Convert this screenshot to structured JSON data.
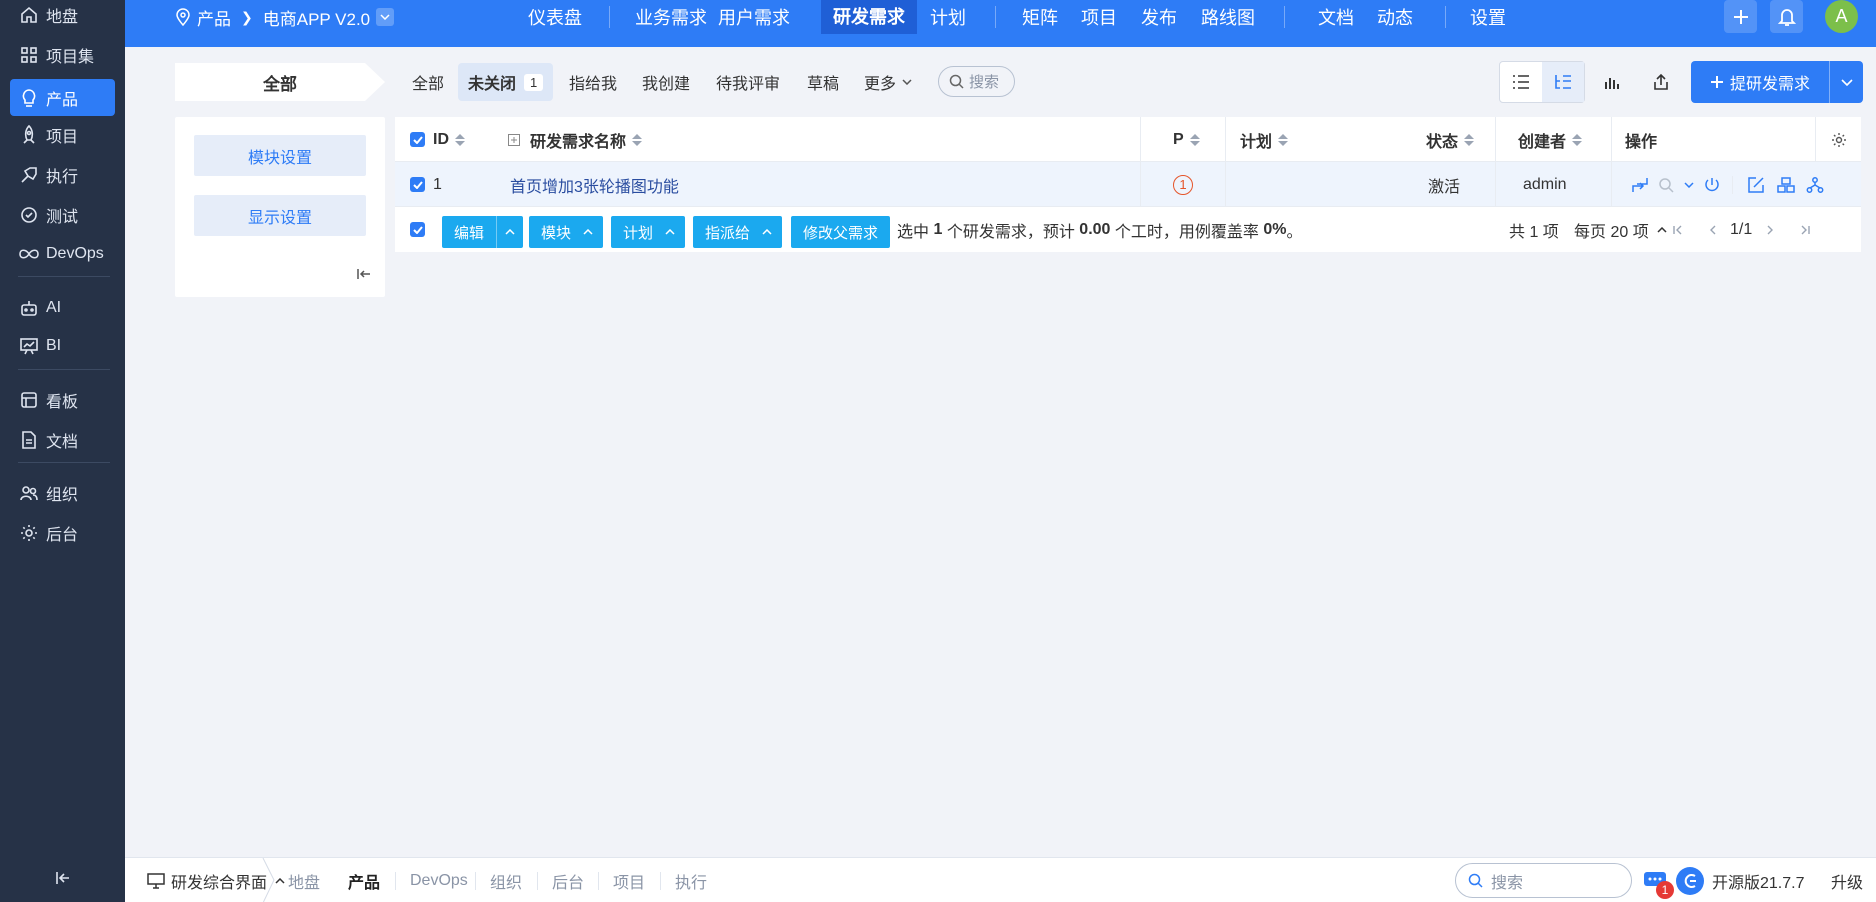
{
  "sidebar": {
    "items": [
      {
        "label": "地盘",
        "icon": "home-icon"
      },
      {
        "label": "项目集",
        "icon": "grid-icon"
      },
      {
        "label": "产品",
        "icon": "bulb-icon"
      },
      {
        "label": "项目",
        "icon": "rocket-icon"
      },
      {
        "label": "执行",
        "icon": "run-icon"
      },
      {
        "label": "测试",
        "icon": "test-icon"
      },
      {
        "label": "DevOps",
        "icon": "infinity-icon"
      },
      {
        "label": "AI",
        "icon": "robot-icon"
      },
      {
        "label": "BI",
        "icon": "chart-board-icon"
      },
      {
        "label": "看板",
        "icon": "kanban-icon"
      },
      {
        "label": "文档",
        "icon": "doc-icon"
      },
      {
        "label": "组织",
        "icon": "users-icon"
      },
      {
        "label": "后台",
        "icon": "gear-icon"
      }
    ],
    "active_index": 2
  },
  "header": {
    "breadcrumb_root": "产品",
    "product_name": "电商APP V2.0",
    "nav_tabs": [
      "仪表盘",
      "业务需求",
      "用户需求",
      "研发需求",
      "计划",
      "矩阵",
      "项目",
      "发布",
      "路线图",
      "文档",
      "动态",
      "设置"
    ],
    "active_tab": "研发需求",
    "avatar_letter": "A"
  },
  "filters": {
    "all_label": "全部",
    "tabs": [
      {
        "label": "全部"
      },
      {
        "label": "未关闭",
        "badge": "1"
      },
      {
        "label": "指给我"
      },
      {
        "label": "我创建"
      },
      {
        "label": "待我评审"
      },
      {
        "label": "草稿"
      },
      {
        "label": "更多"
      }
    ],
    "search_label": "搜索",
    "create_button": "提研发需求"
  },
  "module_panel": {
    "module_settings": "模块设置",
    "display_settings": "显示设置"
  },
  "table": {
    "columns": [
      "ID",
      "研发需求名称",
      "P",
      "计划",
      "状态",
      "创建者",
      "操作"
    ],
    "rows": [
      {
        "id": "1",
        "name": "首页增加3张轮播图功能",
        "priority": "1",
        "plan": "",
        "status": "激活",
        "creator": "admin"
      }
    ]
  },
  "batch": {
    "edit": "编辑",
    "module": "模块",
    "plan": "计划",
    "assign": "指派给",
    "change_parent": "修改父需求",
    "summary_prefix": "选中",
    "selected_count": "1",
    "summary_mid": "个研发需求，预计",
    "hours": "0.00",
    "summary_mid2": "个工时，用例覆盖率",
    "coverage": "0%",
    "summary_end": "。"
  },
  "pager": {
    "total": "共 1 项",
    "per_page": "每页 20 项",
    "page": "1/1"
  },
  "bottombar": {
    "app_switch": "研发综合界面",
    "tabs": [
      "地盘",
      "产品",
      "DevOps",
      "组织",
      "后台",
      "项目",
      "执行"
    ],
    "active_tab": "产品",
    "search_placeholder": "搜索",
    "message_badge": "1",
    "version": "开源版21.7.7",
    "upgrade": "升级"
  },
  "colors": {
    "primary": "#2e7cf6",
    "sidebar_bg": "#263247",
    "batch_btn": "#1ba9ef",
    "priority": "#e5552a"
  }
}
